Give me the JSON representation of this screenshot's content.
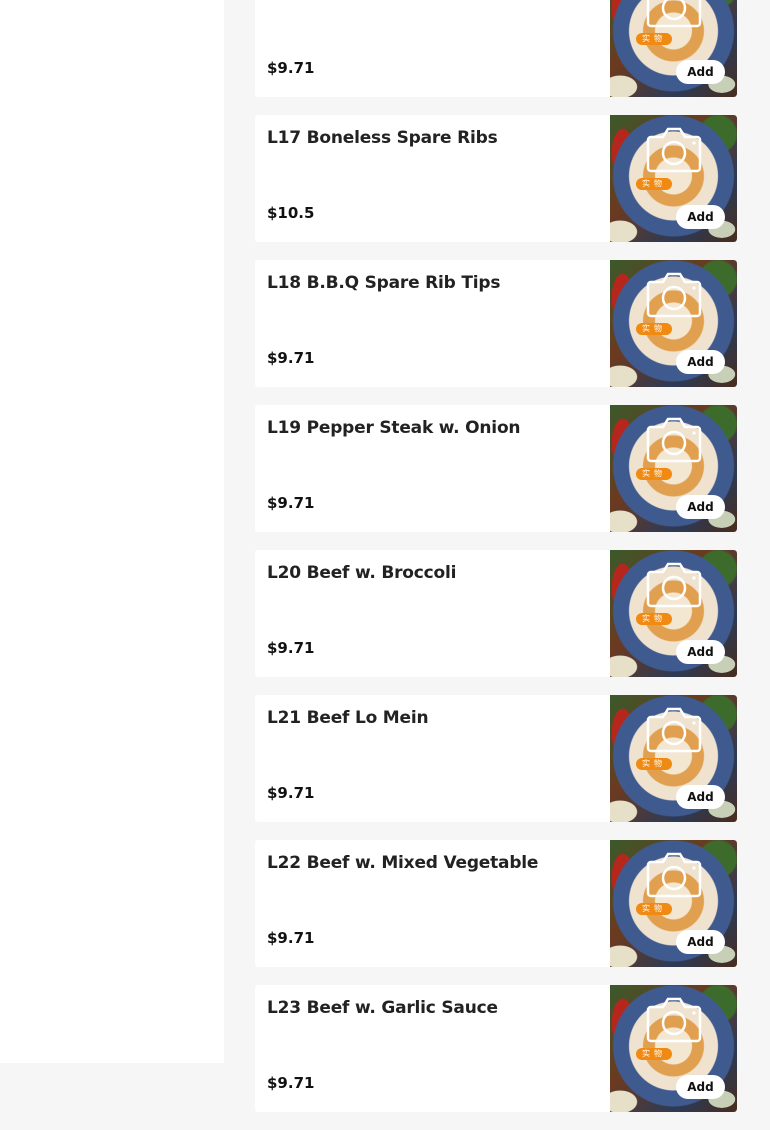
{
  "items": [
    {
      "name": "",
      "price": "$9.71",
      "badge": "实物",
      "button": "Add"
    },
    {
      "name": "L17 Boneless Spare Ribs",
      "price": "$10.5",
      "badge": "实物",
      "button": "Add"
    },
    {
      "name": "L18 B.B.Q Spare Rib Tips",
      "price": "$9.71",
      "badge": "实物",
      "button": "Add"
    },
    {
      "name": "L19 Pepper Steak w. Onion",
      "price": "$9.71",
      "badge": "实物",
      "button": "Add"
    },
    {
      "name": "L20 Beef w. Broccoli",
      "price": "$9.71",
      "badge": "实物",
      "button": "Add"
    },
    {
      "name": "L21 Beef Lo Mein",
      "price": "$9.71",
      "badge": "实物",
      "button": "Add"
    },
    {
      "name": "L22 Beef w. Mixed Vegetable",
      "price": "$9.71",
      "badge": "实物",
      "button": "Add"
    },
    {
      "name": "L23 Beef w. Garlic Sauce",
      "price": "$9.71",
      "badge": "实物",
      "button": "Add"
    }
  ],
  "colors": {
    "page_background": "#f6f6f6",
    "card_background": "#ffffff",
    "badge": "#f08a12"
  },
  "icons": {
    "thumbnail_placeholder": "camera-icon"
  }
}
